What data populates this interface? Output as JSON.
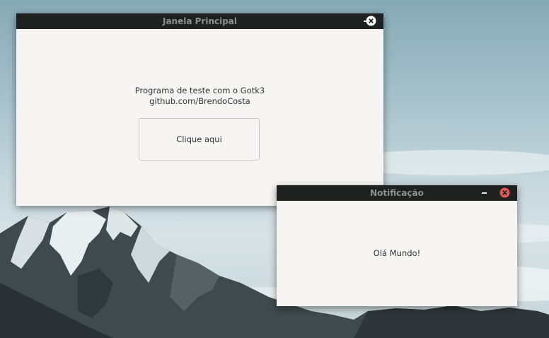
{
  "desktop": {
    "wallpaper": "mountain-sky"
  },
  "main_window": {
    "title": "Janela Principal",
    "label_line1": "Programa de teste com o Gotk3",
    "label_line2": "github.com/BrendoCosta",
    "button_label": "Clique aqui",
    "close_color": "#ffffff"
  },
  "notification_window": {
    "title": "Notificação",
    "message": "Olá Mundo!",
    "close_color": "#e05a5a"
  },
  "colors": {
    "titlebar_bg": "#1f2121",
    "window_bg": "#f6f5f4",
    "title_text": "#8e8f8f"
  },
  "icons": {
    "minimize": "minimize-icon",
    "close": "close-icon"
  }
}
